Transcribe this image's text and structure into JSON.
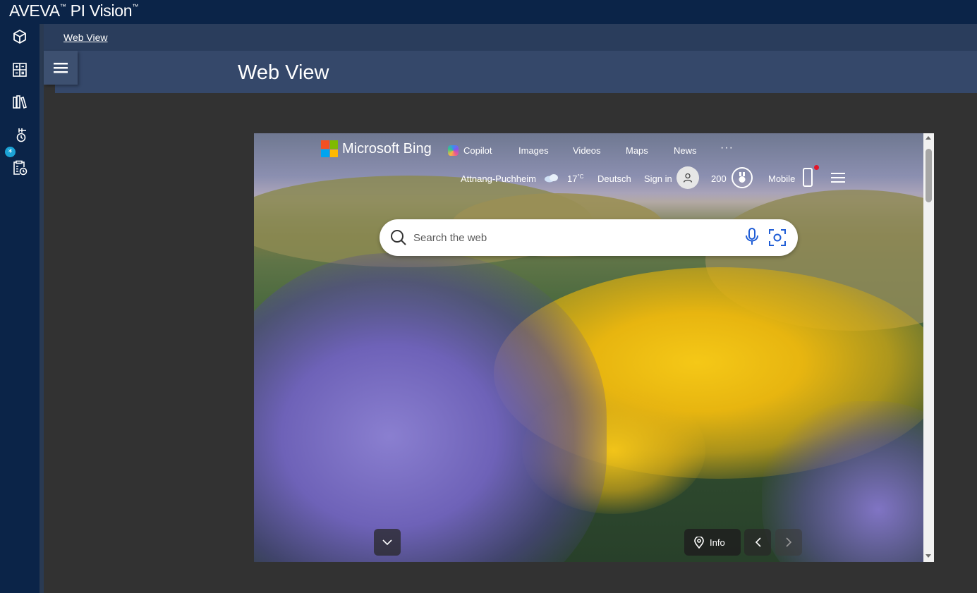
{
  "app": {
    "brand": "AVEVA",
    "product": "PI Vision",
    "tm": "™"
  },
  "leftnav": {
    "items": [
      {
        "name": "displays-icon"
      },
      {
        "name": "calculations-icon"
      },
      {
        "name": "library-icon"
      },
      {
        "name": "events-icon",
        "badge": "*"
      },
      {
        "name": "reports-icon"
      }
    ]
  },
  "breadcrumb": {
    "current": "Web View"
  },
  "header": {
    "title": "Web View"
  },
  "bing": {
    "logo_text": "Microsoft Bing",
    "nav": [
      "Copilot",
      "Images",
      "Videos",
      "Maps",
      "News",
      "···"
    ],
    "location": "Attnang-Puchheim",
    "temperature": "17",
    "temp_unit": "°C",
    "language": "Deutsch",
    "sign_in": "Sign in",
    "points": "200",
    "mobile": "Mobile",
    "search_placeholder": "Search the web",
    "info_label": "Info"
  },
  "colors": {
    "topbar": "#0b2448",
    "header": "#35486a",
    "content_bg": "#323232",
    "badge": "#1ba3d6",
    "ms_red": "#f25022",
    "ms_green": "#7fba00",
    "ms_blue": "#00a4ef",
    "ms_yellow": "#ffb900"
  }
}
